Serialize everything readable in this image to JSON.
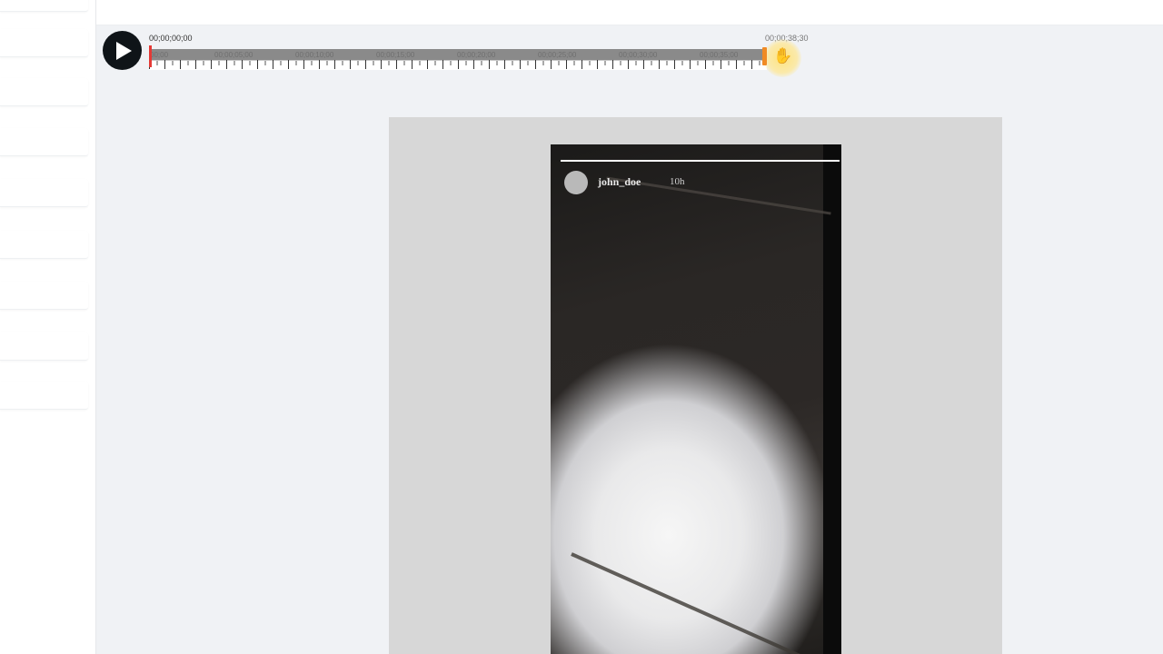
{
  "timeline": {
    "start_time": "00;00;00;00",
    "end_time": "00;00;38;30",
    "tick_labels": [
      "00;00",
      "00;00;05;00",
      "00;00;10;00",
      "00;00;15;00",
      "00;00;20;00",
      "00;00;25;00",
      "00;00;30;00",
      "00;00;35;00"
    ],
    "play_icon": "play-icon",
    "cursor_icon": "hand-grab-icon",
    "playhead_color": "#e53935",
    "end_handle_color": "#f08a24"
  },
  "story": {
    "username": "john_doe",
    "time_ago": "10h",
    "progress": 1.0
  },
  "sidebar": {
    "item_count": 8
  }
}
